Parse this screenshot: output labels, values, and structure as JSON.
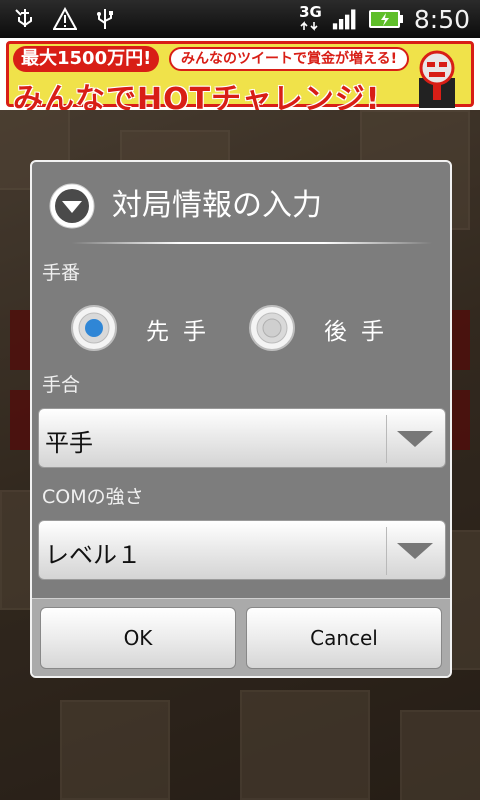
{
  "status_bar": {
    "left_icons": [
      "usb-debug-icon",
      "warning-icon",
      "usb-icon"
    ],
    "network": "3G",
    "time": "8:50"
  },
  "banner": {
    "prize": "最大1500万円!",
    "sub": "みんなのツイートで賞金が増える!",
    "main": "みんなでHOTチャレンジ!"
  },
  "dialog": {
    "title": "対局情報の入力",
    "turn_label": "手番",
    "turn_options": [
      "先手",
      "後手"
    ],
    "turn_selected": "先手",
    "handicap_label": "手合",
    "handicap_value": "平手",
    "com_label": "COMの強さ",
    "com_value": "レベル１",
    "ok_label": "OK",
    "cancel_label": "Cancel"
  },
  "colors": {
    "radio_selected": "#2f86d6",
    "banner_red": "#d81e16",
    "banner_yellow": "#f0e24a"
  }
}
